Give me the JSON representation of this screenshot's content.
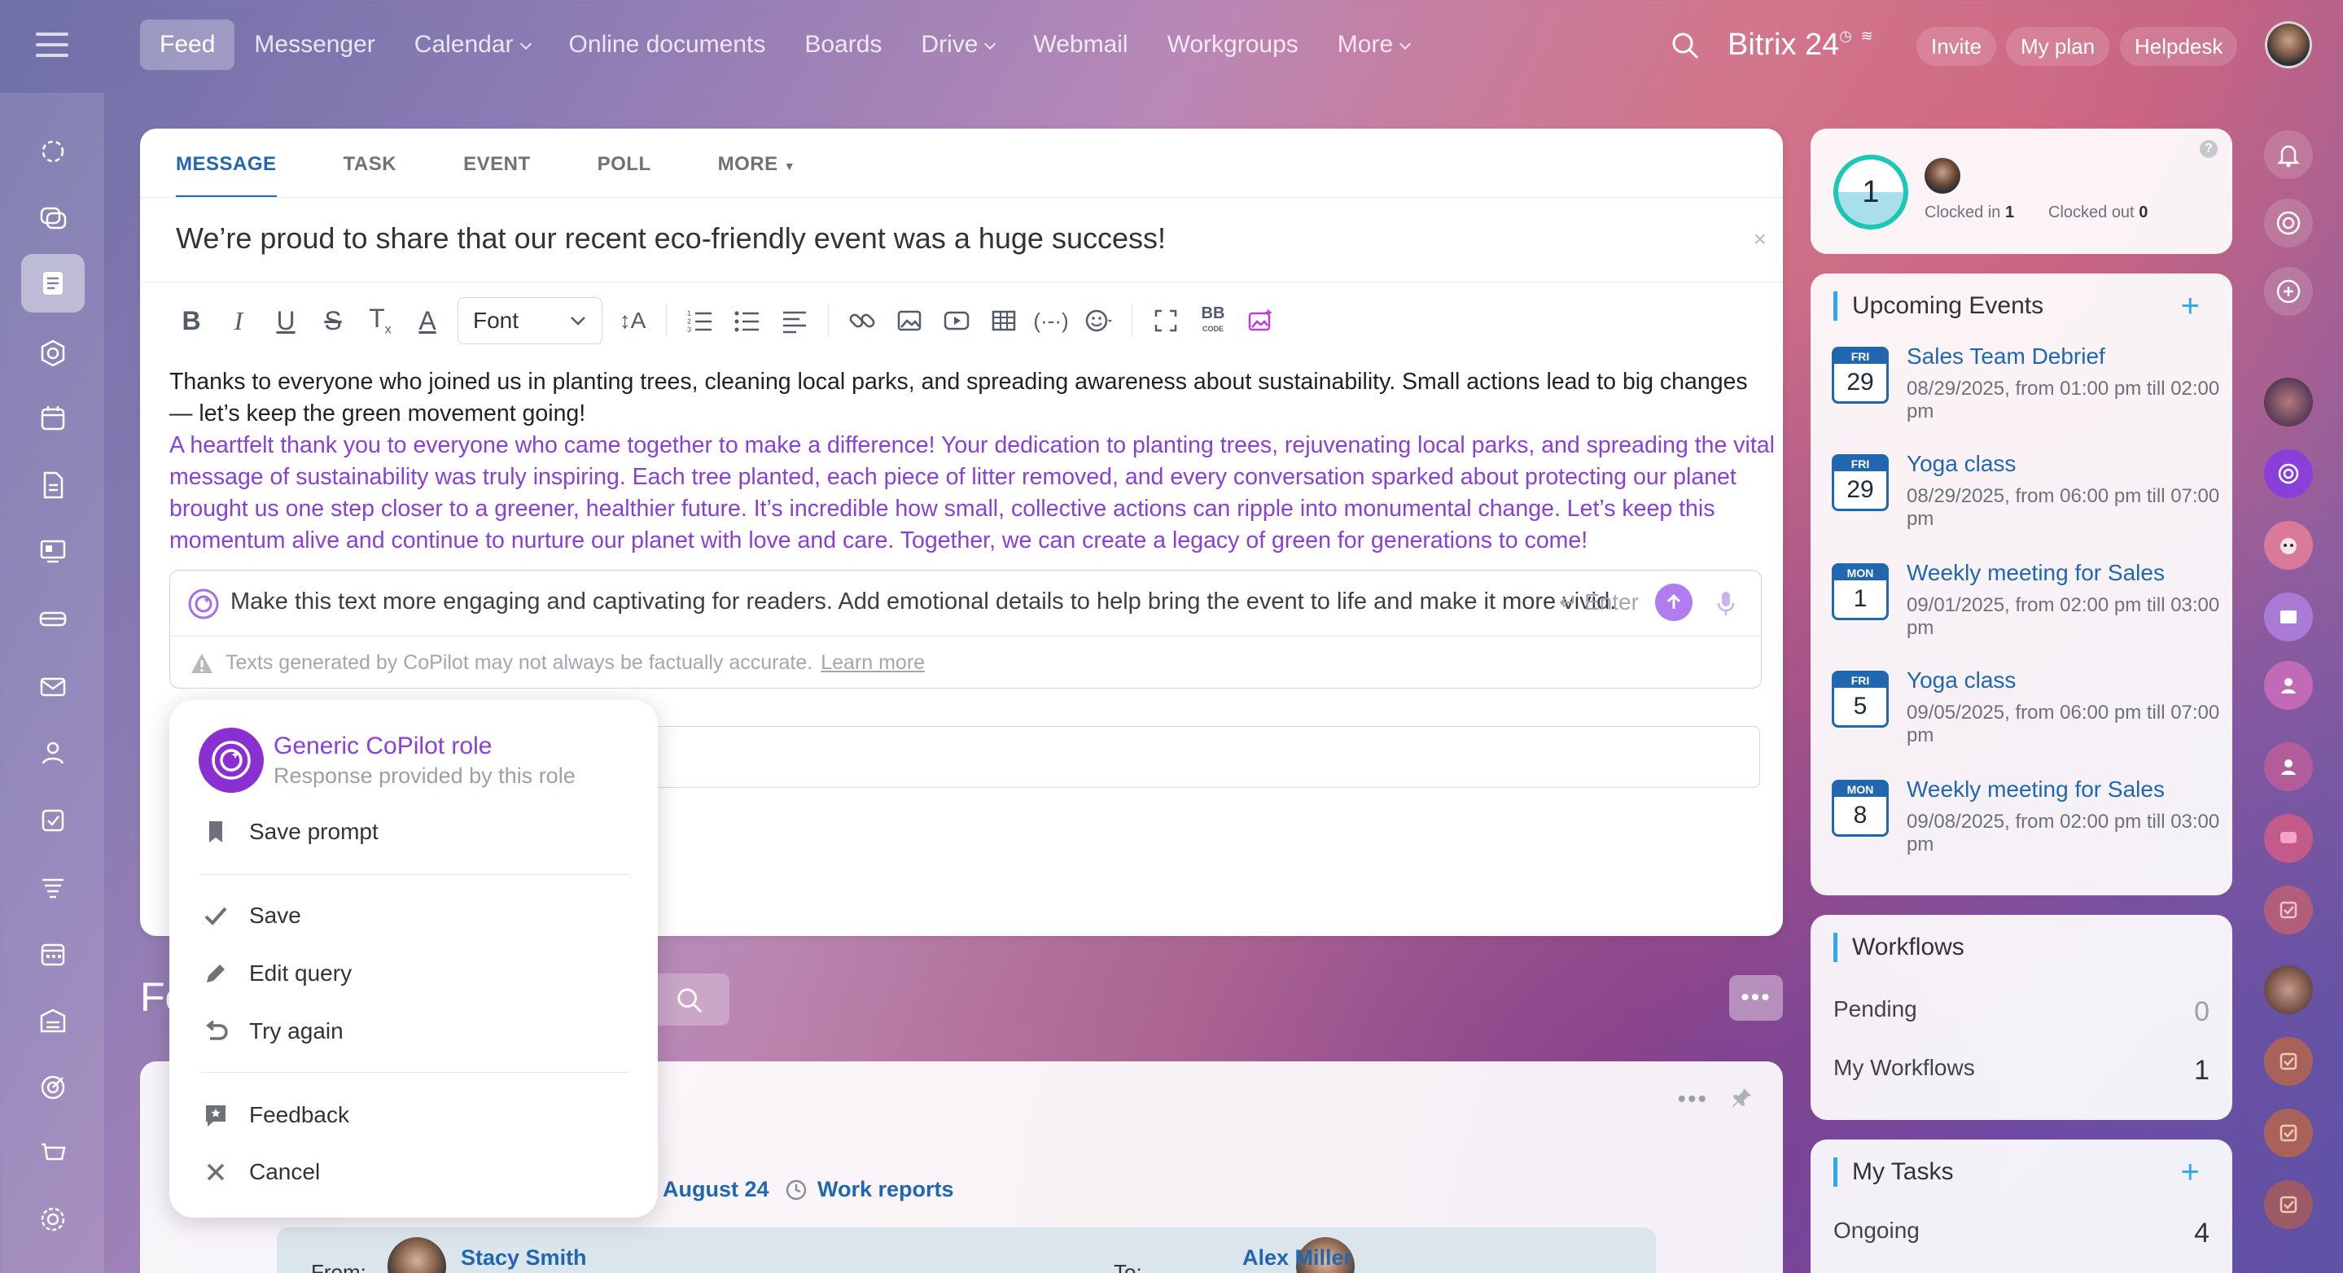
{
  "topnav": {
    "items": [
      {
        "label": "Feed",
        "active": true,
        "dropdown": false
      },
      {
        "label": "Messenger",
        "dropdown": false
      },
      {
        "label": "Calendar",
        "dropdown": true
      },
      {
        "label": "Online documents",
        "dropdown": false
      },
      {
        "label": "Boards",
        "dropdown": false
      },
      {
        "label": "Drive",
        "dropdown": true
      },
      {
        "label": "Webmail",
        "dropdown": false
      },
      {
        "label": "Workgroups",
        "dropdown": false
      },
      {
        "label": "More",
        "dropdown": true
      }
    ],
    "brand": "Bitrix",
    "brand_num": "24",
    "invite": "Invite",
    "my_plan": "My plan",
    "helpdesk": "Helpdesk"
  },
  "composer": {
    "tabs": [
      "MESSAGE",
      "TASK",
      "EVENT",
      "POLL",
      "MORE"
    ],
    "subject": "We’re proud to share that our recent eco-friendly event was a huge success!",
    "font_select": "Font",
    "body_plain": "Thanks to everyone who joined us in planting trees, cleaning local parks, and spreading awareness about sustainability. Small actions lead to big changes — let’s keep the green movement going!",
    "body_ai": "A heartfelt thank you to everyone who came together to make a difference! Your dedication to planting trees, rejuvenating local parks, and spreading the vital message of sustainability was truly inspiring. Each tree planted, each piece of litter removed, and every conversation sparked about protecting our planet brought us one step closer to a greener, healthier future. It’s incredible how small, collective actions can ripple into monumental change. Let’s keep this momentum alive and continue to nurture our planet with love and care. Together, we can create a legacy of green for generations to come!",
    "copilot_prompt": "Make this text more engaging and captivating for readers. Add emotional details to help bring the event to life and make it more vivid.",
    "copilot_enter": "Enter",
    "copilot_warning": "Texts generated by CoPilot may not always be factually accurate.",
    "copilot_learn_more": "Learn more"
  },
  "copilot_menu": {
    "role_title": "Generic CoPilot role",
    "role_sub": "Response provided by this role",
    "save_prompt": "Save prompt",
    "save": "Save",
    "edit_query": "Edit query",
    "try_again": "Try again",
    "feedback": "Feedback",
    "cancel": "Cancel"
  },
  "feed": {
    "title_partial": "Fe",
    "post_date": "August 24",
    "post_category": "Work reports",
    "from_label": "From:",
    "from_name": "Stacy Smith",
    "to_label": "To:",
    "to_name": "Alex Miller"
  },
  "timeman": {
    "count": "1",
    "clocked_in_label": "Clocked in",
    "clocked_in_value": "1",
    "clocked_out_label": "Clocked out",
    "clocked_out_value": "0"
  },
  "upcoming_events": {
    "title": "Upcoming Events",
    "events": [
      {
        "dow": "FRI",
        "day": "29",
        "title": "Sales Team Debrief",
        "when": "08/29/2025, from 01:00 pm till 02:00 pm"
      },
      {
        "dow": "FRI",
        "day": "29",
        "title": "Yoga class",
        "when": "08/29/2025, from 06:00 pm till 07:00 pm"
      },
      {
        "dow": "MON",
        "day": "1",
        "title": "Weekly meeting for Sales",
        "when": "09/01/2025, from 02:00 pm till 03:00 pm"
      },
      {
        "dow": "FRI",
        "day": "5",
        "title": "Yoga class",
        "when": "09/05/2025, from 06:00 pm till 07:00 pm"
      },
      {
        "dow": "MON",
        "day": "8",
        "title": "Weekly meeting for Sales",
        "when": "09/08/2025, from 02:00 pm till 03:00 pm"
      }
    ]
  },
  "workflows": {
    "title": "Workflows",
    "pending_label": "Pending",
    "pending_value": "0",
    "my_label": "My Workflows",
    "my_value": "1"
  },
  "my_tasks": {
    "title": "My Tasks",
    "ongoing_label": "Ongoing",
    "ongoing_value": "4"
  },
  "colors": {
    "accent_blue": "#2067b0",
    "copilot_purple": "#8b3fd9",
    "timer_teal": "#1cc7b6"
  }
}
